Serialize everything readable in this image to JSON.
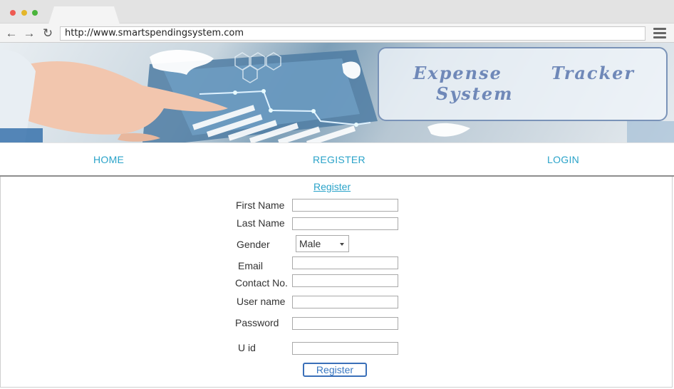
{
  "browser": {
    "url": "http://www.smartspendingsystem.com",
    "back_icon": "arrow-left-icon",
    "forward_icon": "arrow-right-icon",
    "reload_icon": "reload-icon",
    "menu_icon": "hamburger-menu-icon"
  },
  "banner": {
    "title_line1": "Expense  Tracker",
    "title_line2": "System"
  },
  "nav": {
    "home": "HOME",
    "register": "REGISTER",
    "login": "LOGIN"
  },
  "form": {
    "heading": "Register",
    "first_name": {
      "label": "First Name",
      "value": ""
    },
    "last_name": {
      "label": "Last Name",
      "value": ""
    },
    "gender": {
      "label": "Gender",
      "selected": "Male"
    },
    "email": {
      "label": "Email",
      "value": ""
    },
    "contact": {
      "label": "Contact No.",
      "value": ""
    },
    "username": {
      "label": "User name",
      "value": ""
    },
    "password": {
      "label": "Password",
      "value": ""
    },
    "uid": {
      "label": "U id",
      "value": ""
    },
    "submit_label": "Register"
  },
  "colors": {
    "link": "#2aa3c9",
    "title": "#6f88b8",
    "button_border": "#3a6fb8"
  }
}
